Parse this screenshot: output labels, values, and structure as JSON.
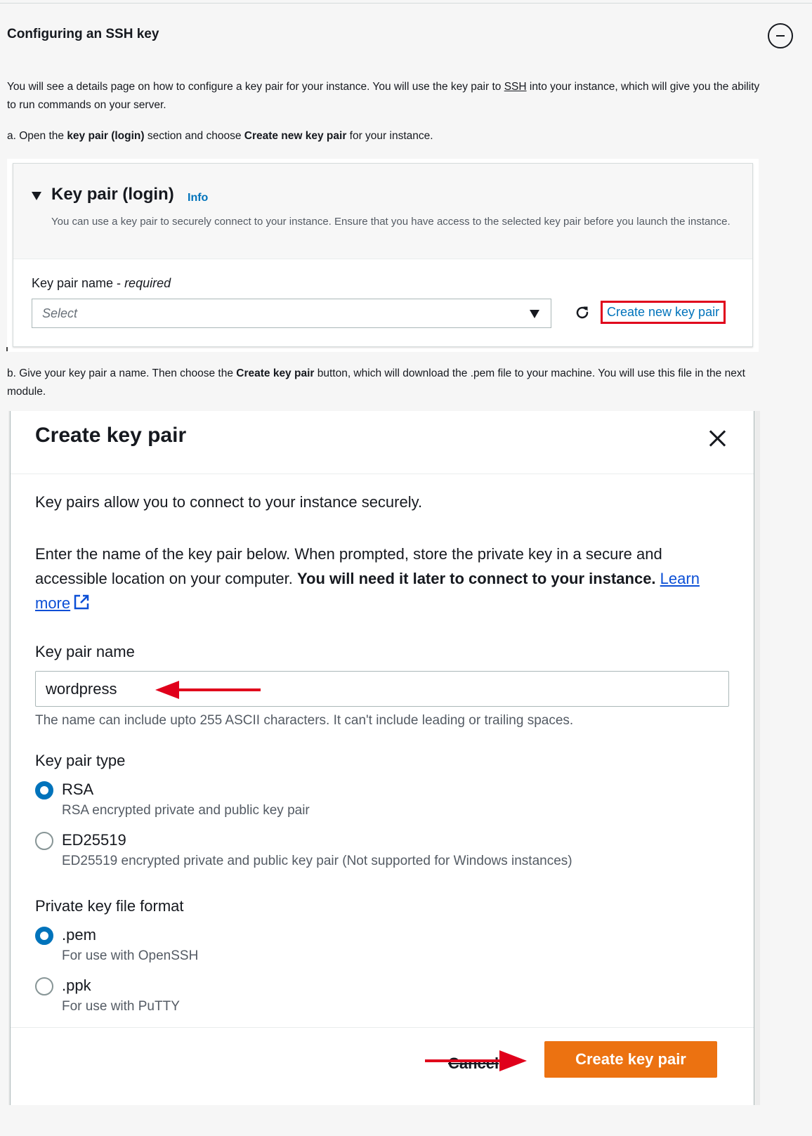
{
  "section": {
    "title": "Configuring an SSH key",
    "collapse_icon": "minus-circle-icon"
  },
  "intro": {
    "before": "You will see a details page on how to configure a key pair for your instance. You will use the key pair to ",
    "ssh": "SSH",
    "after": " into your instance, which will give you the ability to run commands on your server."
  },
  "step_a": {
    "prefix": "a. Open the ",
    "bold1": "key pair (login)",
    "mid": " section and choose ",
    "bold2": "Create new key pair",
    "suffix": " for your instance."
  },
  "keypair_panel": {
    "title": "Key pair (login)",
    "info_link": "Info",
    "description": "You can use a key pair to securely connect to your instance. Ensure that you have access to the selected key pair before you launch the instance.",
    "field_label": "Key pair name - ",
    "field_required": "required",
    "select_placeholder": "Select",
    "refresh_icon": "refresh-icon",
    "create_link": "Create new key pair"
  },
  "step_b": {
    "prefix": "b. Give your key pair a name. Then choose the ",
    "bold": "Create key pair",
    "suffix": " button, which will download the .pem file to your machine. You will use this file in the next module."
  },
  "modal": {
    "title": "Create key pair",
    "close_icon": "close-icon",
    "lead": "Key pairs allow you to connect to your instance securely.",
    "body_text": "Enter the name of the key pair below. When prompted, store the private key in a secure and accessible location on your computer. ",
    "body_bold": "You will need it later to connect to your instance.",
    "learn_more": "Learn more",
    "external_icon": "external-link-icon",
    "name_label": "Key pair name",
    "name_value": "wordpress",
    "name_hint": "The name can include upto 255 ASCII characters. It can't include leading or trailing spaces.",
    "type_label": "Key pair type",
    "type_options": [
      {
        "label": "RSA",
        "desc": "RSA encrypted private and public key pair",
        "selected": true
      },
      {
        "label": "ED25519",
        "desc": "ED25519 encrypted private and public key pair (Not supported for Windows instances)",
        "selected": false
      }
    ],
    "format_label": "Private key file format",
    "format_options": [
      {
        "label": ".pem",
        "desc": "For use with OpenSSH",
        "selected": true
      },
      {
        "label": ".ppk",
        "desc": "For use with PuTTY",
        "selected": false
      }
    ],
    "cancel_label": "Cancel",
    "submit_label": "Create key pair"
  },
  "colors": {
    "accent_blue": "#0073bb",
    "highlight_red": "#e0001b",
    "primary_orange": "#ec7211"
  }
}
